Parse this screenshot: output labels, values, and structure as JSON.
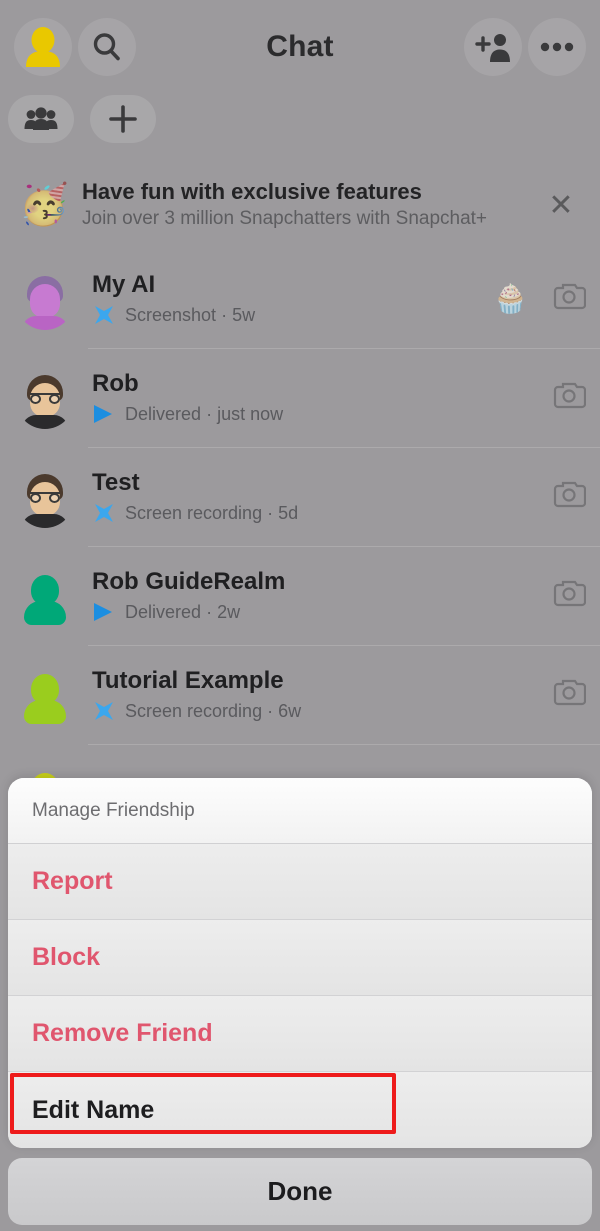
{
  "app": {
    "name": "Snapchat",
    "screen_title": "Chat",
    "background_color": "#9c9a9d",
    "accent_red": "#e0566e",
    "annotation_color": "#ee1b1b"
  },
  "header": {
    "title": "Chat",
    "left_icons": [
      {
        "name": "profile-bitmoji-icon",
        "label": "Profile",
        "color": "#e9c800"
      },
      {
        "name": "search-icon",
        "label": "Search"
      }
    ],
    "right_icons": [
      {
        "name": "add-friend-icon",
        "label": "Add Friend"
      },
      {
        "name": "more-options-icon",
        "label": "More"
      }
    ],
    "sub_icons": [
      {
        "name": "groups-icon",
        "label": "Groups"
      },
      {
        "name": "new-chat-icon",
        "label": "New Chat"
      }
    ]
  },
  "promo": {
    "emoji": "🥳",
    "emoji_name": "party-face-emoji",
    "title": "Have fun with exclusive features",
    "subtitle": "Join over 3 million Snapchatters with Snapchat+",
    "close_label": "✕"
  },
  "chats": [
    {
      "name": "My AI",
      "status": "Screenshot",
      "time": "5w",
      "separator": "·",
      "status_icon": "screenshot-icon",
      "avatar": "bitmoji-purple",
      "badge_emoji": "🧁",
      "badge_name": "cupcake-emoji",
      "camera_icon": "camera-icon"
    },
    {
      "name": "Rob",
      "status": "Delivered",
      "time": "just now",
      "separator": "·",
      "status_icon": "delivered-arrow-icon",
      "avatar": "bitmoji-dark",
      "badge_emoji": "",
      "badge_name": "",
      "camera_icon": "camera-icon"
    },
    {
      "name": "Test",
      "status": "Screen recording",
      "time": "5d",
      "separator": "·",
      "status_icon": "screenshot-icon",
      "avatar": "bitmoji-dark",
      "badge_emoji": "",
      "badge_name": "",
      "camera_icon": "camera-icon"
    },
    {
      "name": "Rob GuideRealm",
      "status": "Delivered",
      "time": "2w",
      "separator": "·",
      "status_icon": "delivered-arrow-icon",
      "avatar": "silhouette-teal",
      "badge_emoji": "",
      "badge_name": "",
      "camera_icon": "camera-icon"
    },
    {
      "name": "Tutorial Example",
      "status": "Screen recording",
      "time": "6w",
      "separator": "·",
      "status_icon": "screenshot-icon",
      "avatar": "silhouette-green",
      "badge_emoji": "",
      "badge_name": "",
      "camera_icon": "camera-icon"
    }
  ],
  "action_sheet": {
    "header": "Manage Friendship",
    "items": [
      {
        "label": "Report",
        "style": "destructive"
      },
      {
        "label": "Block",
        "style": "destructive"
      },
      {
        "label": "Remove Friend",
        "style": "destructive"
      },
      {
        "label": "Edit Name",
        "style": "neutral",
        "highlighted": true
      }
    ],
    "done_label": "Done"
  }
}
